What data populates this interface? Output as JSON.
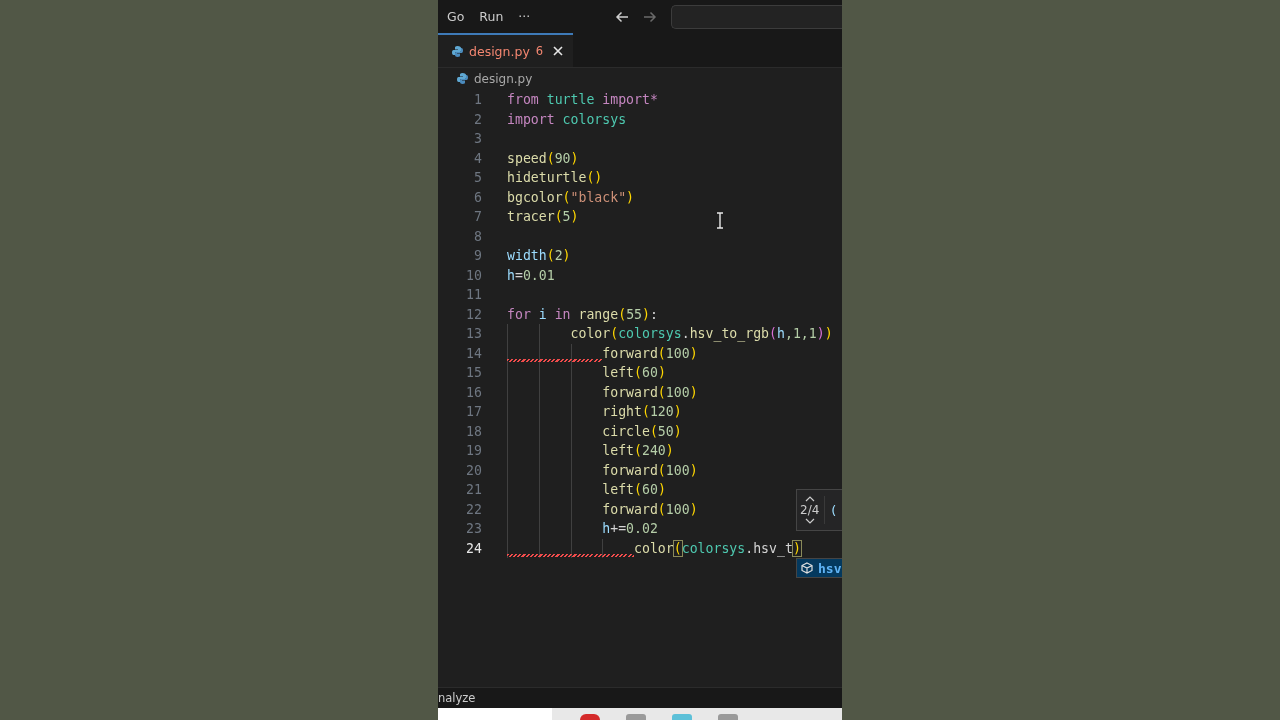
{
  "menu": [
    "Go",
    "Run",
    "···"
  ],
  "nav": {
    "back_disabled": false,
    "forward_disabled": true
  },
  "tab": {
    "label": "design.py",
    "problems": "6",
    "has_errors": true,
    "selected": true
  },
  "breadcrumb": "design.py",
  "lines": [
    {
      "number": "1",
      "tokens": [
        {
          "text": "from ",
          "kind": "kw"
        },
        {
          "text": "turtle ",
          "kind": "mod"
        },
        {
          "text": "import*",
          "kind": "kw"
        }
      ]
    },
    {
      "number": "2",
      "tokens": [
        {
          "text": "import ",
          "kind": "kw"
        },
        {
          "text": "colorsys",
          "kind": "mod"
        }
      ]
    },
    {
      "number": "3"
    },
    {
      "number": "4",
      "tokens": [
        {
          "text": "speed",
          "kind": "fn"
        },
        {
          "text": "(",
          "kind": "p1"
        },
        {
          "text": "90",
          "kind": "num"
        },
        {
          "text": ")",
          "kind": "p1"
        }
      ]
    },
    {
      "number": "5",
      "tokens": [
        {
          "text": "hideturtle",
          "kind": "fn"
        },
        {
          "text": "()",
          "kind": "p1"
        }
      ]
    },
    {
      "number": "6",
      "tokens": [
        {
          "text": "bgcolor",
          "kind": "fn"
        },
        {
          "text": "(",
          "kind": "p1"
        },
        {
          "text": "\"black\"",
          "kind": "str"
        },
        {
          "text": ")",
          "kind": "p1"
        }
      ]
    },
    {
      "number": "7",
      "tokens": [
        {
          "text": "tracer",
          "kind": "fn"
        },
        {
          "text": "(",
          "kind": "p1"
        },
        {
          "text": "5",
          "kind": "num"
        },
        {
          "text": ")",
          "kind": "p1"
        }
      ]
    },
    {
      "number": "8"
    },
    {
      "number": "9",
      "tokens": [
        {
          "text": "width",
          "kind": "var"
        },
        {
          "text": "(",
          "kind": "p1"
        },
        {
          "text": "2",
          "kind": "num"
        },
        {
          "text": ")",
          "kind": "p1"
        }
      ]
    },
    {
      "number": "10",
      "tokens": [
        {
          "text": "h",
          "kind": "var"
        },
        {
          "text": "=",
          "kind": "op"
        },
        {
          "text": "0.01",
          "kind": "num"
        }
      ]
    },
    {
      "number": "11"
    },
    {
      "number": "12",
      "tokens": [
        {
          "text": "for ",
          "kind": "kw"
        },
        {
          "text": "i ",
          "kind": "var"
        },
        {
          "text": "in ",
          "kind": "kw"
        },
        {
          "text": "range",
          "kind": "fn"
        },
        {
          "text": "(",
          "kind": "p1"
        },
        {
          "text": "55",
          "kind": "num"
        },
        {
          "text": ")",
          "kind": "p1"
        },
        {
          "text": ":",
          "kind": "op"
        }
      ]
    },
    {
      "number": "13",
      "tokens": [
        {
          "text": "        color",
          "kind": "fn"
        },
        {
          "text": "(",
          "kind": "p1"
        },
        {
          "text": "colorsys",
          "kind": "mod"
        },
        {
          "text": ".",
          "kind": "op"
        },
        {
          "text": "hsv_to_rgb",
          "kind": "fn"
        },
        {
          "text": "(",
          "kind": "p2"
        },
        {
          "text": "h",
          "kind": "var"
        },
        {
          "text": ",1,1",
          "kind": "num"
        },
        {
          "text": ")",
          "kind": "p2"
        },
        {
          "text": ")",
          "kind": "p1"
        }
      ]
    },
    {
      "number": "14",
      "error": true,
      "tokens": [
        {
          "text": "            forward",
          "kind": "fn"
        },
        {
          "text": "(",
          "kind": "p1"
        },
        {
          "text": "100",
          "kind": "num"
        },
        {
          "text": ")",
          "kind": "p1"
        }
      ]
    },
    {
      "number": "15",
      "tokens": [
        {
          "text": "            left",
          "kind": "fn"
        },
        {
          "text": "(",
          "kind": "p1"
        },
        {
          "text": "60",
          "kind": "num"
        },
        {
          "text": ")",
          "kind": "p1"
        }
      ]
    },
    {
      "number": "16",
      "tokens": [
        {
          "text": "            forward",
          "kind": "fn"
        },
        {
          "text": "(",
          "kind": "p1"
        },
        {
          "text": "100",
          "kind": "num"
        },
        {
          "text": ")",
          "kind": "p1"
        }
      ]
    },
    {
      "number": "17",
      "tokens": [
        {
          "text": "            right",
          "kind": "fn"
        },
        {
          "text": "(",
          "kind": "p1"
        },
        {
          "text": "120",
          "kind": "num"
        },
        {
          "text": ")",
          "kind": "p1"
        }
      ]
    },
    {
      "number": "18",
      "tokens": [
        {
          "text": "            circle",
          "kind": "fn"
        },
        {
          "text": "(",
          "kind": "p1"
        },
        {
          "text": "50",
          "kind": "num"
        },
        {
          "text": ")",
          "kind": "p1"
        }
      ]
    },
    {
      "number": "19",
      "tokens": [
        {
          "text": "            left",
          "kind": "fn"
        },
        {
          "text": "(",
          "kind": "p1"
        },
        {
          "text": "240",
          "kind": "num"
        },
        {
          "text": ")",
          "kind": "p1"
        }
      ]
    },
    {
      "number": "20",
      "tokens": [
        {
          "text": "            forward",
          "kind": "fn"
        },
        {
          "text": "(",
          "kind": "p1"
        },
        {
          "text": "100",
          "kind": "num"
        },
        {
          "text": ")",
          "kind": "p1"
        }
      ]
    },
    {
      "number": "21",
      "tokens": [
        {
          "text": "            left",
          "kind": "fn"
        },
        {
          "text": "(",
          "kind": "p1"
        },
        {
          "text": "60",
          "kind": "num"
        },
        {
          "text": ")",
          "kind": "p1"
        }
      ]
    },
    {
      "number": "22",
      "tokens": [
        {
          "text": "            forward",
          "kind": "fn"
        },
        {
          "text": "(",
          "kind": "p1"
        },
        {
          "text": "100",
          "kind": "num"
        },
        {
          "text": ")",
          "kind": "p1"
        }
      ]
    },
    {
      "number": "23",
      "tokens": [
        {
          "text": "            h",
          "kind": "var"
        },
        {
          "text": "+=",
          "kind": "op"
        },
        {
          "text": "0.02",
          "kind": "num"
        }
      ]
    },
    {
      "number": "24",
      "error": true,
      "current": true,
      "tokens": [
        {
          "text": "                color",
          "kind": "fn"
        },
        {
          "text": "(",
          "kind": "match"
        },
        {
          "text": "colorsys",
          "kind": "mod"
        },
        {
          "text": ".",
          "kind": "op"
        },
        {
          "text": "hsv_t",
          "kind": "plain"
        },
        {
          "text": ")",
          "kind": "match"
        }
      ]
    }
  ],
  "parameter_hint": {
    "counter": "2/4",
    "signature": "("
  },
  "suggestion": {
    "label": "hsv"
  },
  "status_bar": {
    "text": "nalyze"
  }
}
